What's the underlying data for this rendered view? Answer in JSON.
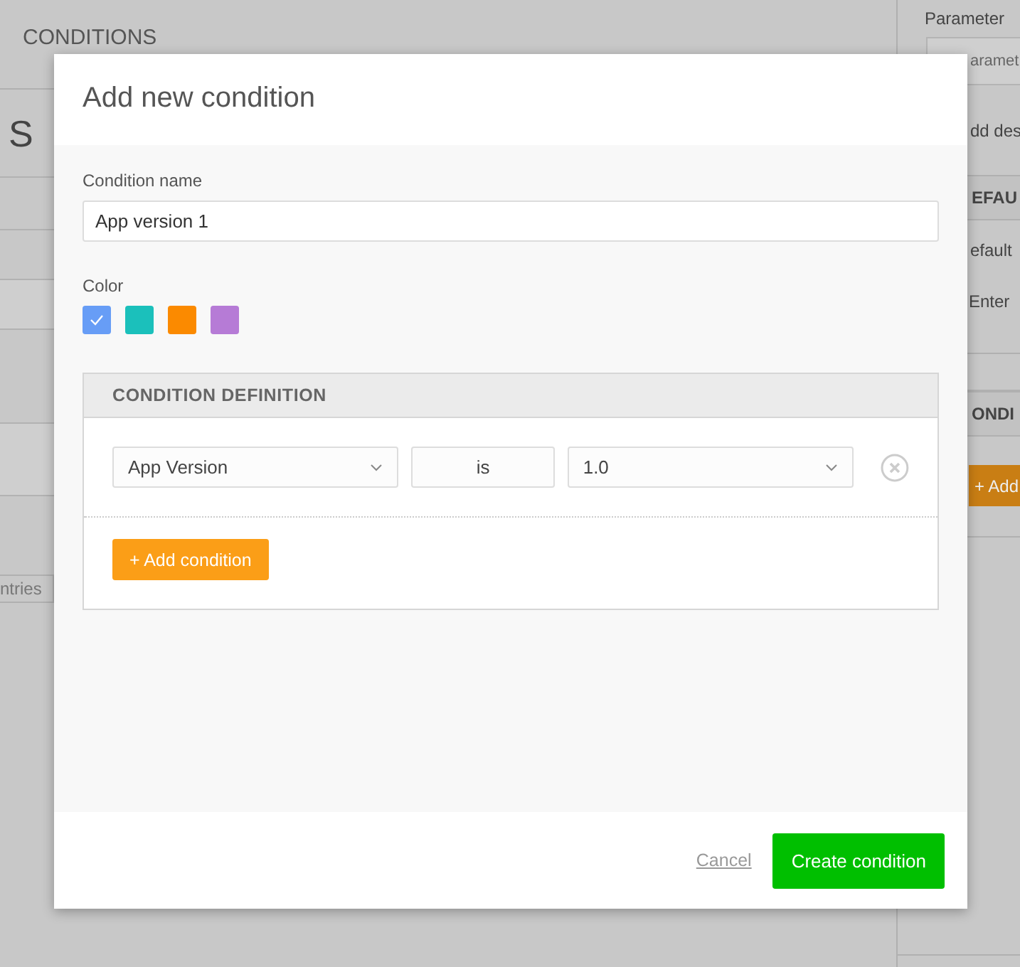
{
  "background": {
    "section_title": "CONDITIONS",
    "panel_title": "S",
    "footer_text": "ntries",
    "sidebar": {
      "label": "Parameter",
      "key_placeholder": "aramet",
      "description_link": "dd des",
      "default_header": "EFAU",
      "default_label": "efault",
      "value_placeholder": "Enter",
      "conditions_header": "ONDI",
      "add_button": "+ Add"
    }
  },
  "dialog": {
    "title": "Add new condition",
    "name_label": "Condition name",
    "name_value": "App version 1",
    "color_label": "Color",
    "colors": [
      {
        "color": "#679df6",
        "selected": true
      },
      {
        "color": "#1bc0bb",
        "selected": false
      },
      {
        "color": "#fb8a00",
        "selected": false
      },
      {
        "color": "#b67bd6",
        "selected": false
      }
    ],
    "definition": {
      "title": "CONDITION DEFINITION",
      "rules": [
        {
          "attribute": "App Version",
          "operator": "is",
          "value": "1.0"
        }
      ],
      "add_button": "+ Add condition"
    },
    "cancel": "Cancel",
    "submit": "Create condition"
  }
}
